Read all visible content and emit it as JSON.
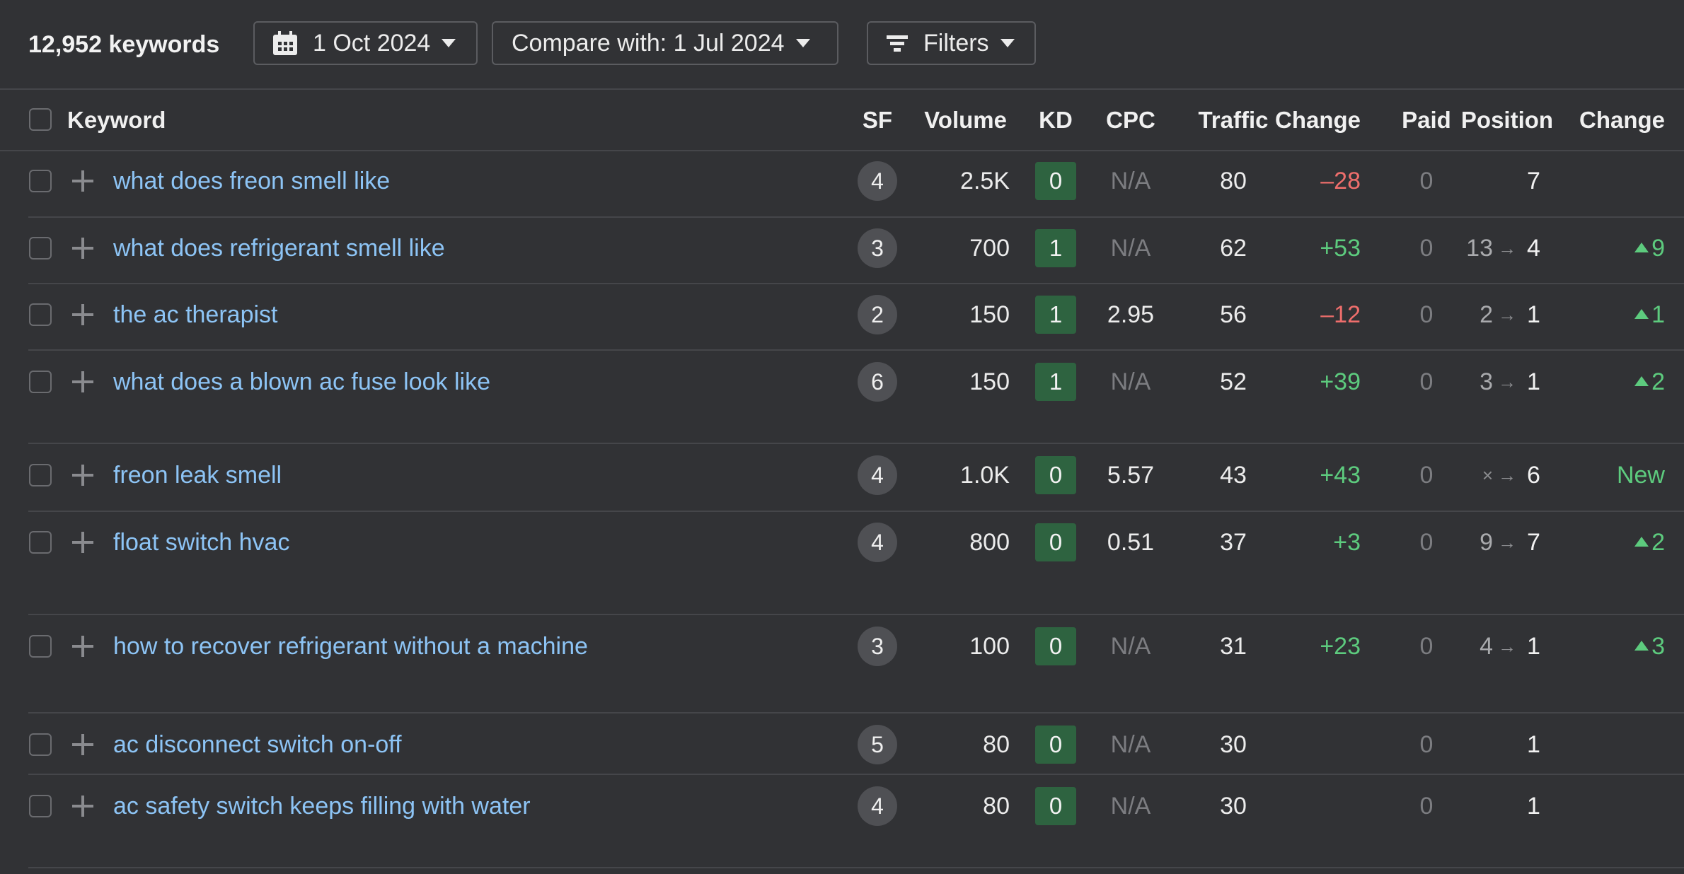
{
  "toolbar": {
    "keyword_count": "12,952 keywords",
    "date_label": "1 Oct 2024",
    "compare_label": "Compare with: 1 Jul 2024",
    "filters_label": "Filters",
    "icons": {
      "date": "calendar-icon",
      "filters": "filter-icon",
      "dropdown": "caret-down-icon"
    }
  },
  "table": {
    "columns": [
      "Keyword",
      "SF",
      "Volume",
      "KD",
      "CPC",
      "Traffic",
      "Change",
      "Paid",
      "Position",
      "Change"
    ],
    "rows": [
      {
        "keyword": "what does freon smell like",
        "sf": "4",
        "volume": "2.5K",
        "kd": "0",
        "cpc": "N/A",
        "traffic": "80",
        "traffic_change": "–28",
        "traffic_change_dir": "down",
        "paid": "0",
        "position_from": "",
        "position_to": "7",
        "position_change": "",
        "position_change_dir": "none"
      },
      {
        "keyword": "what does refrigerant smell like",
        "sf": "3",
        "volume": "700",
        "kd": "1",
        "cpc": "N/A",
        "traffic": "62",
        "traffic_change": "+53",
        "traffic_change_dir": "up",
        "paid": "0",
        "position_from": "13",
        "position_to": "4",
        "position_change": "9",
        "position_change_dir": "up"
      },
      {
        "keyword": "the ac therapist",
        "sf": "2",
        "volume": "150",
        "kd": "1",
        "cpc": "2.95",
        "traffic": "56",
        "traffic_change": "–12",
        "traffic_change_dir": "down",
        "paid": "0",
        "position_from": "2",
        "position_to": "1",
        "position_change": "1",
        "position_change_dir": "up"
      },
      {
        "keyword": "what does a blown ac fuse look like",
        "sf": "6",
        "volume": "150",
        "kd": "1",
        "cpc": "N/A",
        "traffic": "52",
        "traffic_change": "+39",
        "traffic_change_dir": "up",
        "paid": "0",
        "position_from": "3",
        "position_to": "1",
        "position_change": "2",
        "position_change_dir": "up"
      },
      {
        "keyword": "freon leak smell",
        "sf": "4",
        "volume": "1.0K",
        "kd": "0",
        "cpc": "5.57",
        "traffic": "43",
        "traffic_change": "+43",
        "traffic_change_dir": "up",
        "paid": "0",
        "position_from": "×",
        "position_to": "6",
        "position_change": "New",
        "position_change_dir": "new"
      },
      {
        "keyword": "float switch hvac",
        "sf": "4",
        "volume": "800",
        "kd": "0",
        "cpc": "0.51",
        "traffic": "37",
        "traffic_change": "+3",
        "traffic_change_dir": "up",
        "paid": "0",
        "position_from": "9",
        "position_to": "7",
        "position_change": "2",
        "position_change_dir": "up"
      },
      {
        "keyword": "how to recover refrigerant without a machine",
        "sf": "3",
        "volume": "100",
        "kd": "0",
        "cpc": "N/A",
        "traffic": "31",
        "traffic_change": "+23",
        "traffic_change_dir": "up",
        "paid": "0",
        "position_from": "4",
        "position_to": "1",
        "position_change": "3",
        "position_change_dir": "up"
      },
      {
        "keyword": "ac disconnect switch on-off",
        "sf": "5",
        "volume": "80",
        "kd": "0",
        "cpc": "N/A",
        "traffic": "30",
        "traffic_change": "",
        "traffic_change_dir": "none",
        "paid": "0",
        "position_from": "",
        "position_to": "1",
        "position_change": "",
        "position_change_dir": "none"
      },
      {
        "keyword": "ac safety switch keeps filling with water",
        "sf": "4",
        "volume": "80",
        "kd": "0",
        "cpc": "N/A",
        "traffic": "30",
        "traffic_change": "",
        "traffic_change_dir": "none",
        "paid": "0",
        "position_from": "",
        "position_to": "1",
        "position_change": "",
        "position_change_dir": "none"
      }
    ]
  },
  "colors": {
    "background": "#313235",
    "keyword_link": "#8dc4f5",
    "kd_badge": "#2e6340",
    "positive": "#5dcb7e",
    "negative": "#ee6e6c",
    "muted": "#7c7d81"
  }
}
